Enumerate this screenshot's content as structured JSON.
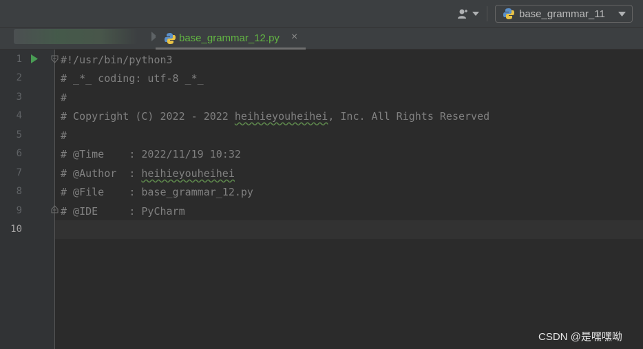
{
  "toolbar": {
    "user_icon": "user-icon",
    "run_config_label": "base_grammar_11",
    "run_config_icon": "python-icon"
  },
  "tabs": [
    {
      "label": "",
      "state": "inactive",
      "blurred": true
    },
    {
      "label": "base_grammar_12.py",
      "state": "active",
      "icon": "python-icon",
      "close": "×"
    }
  ],
  "editor": {
    "lines": [
      {
        "num": "1",
        "pre": "#!/usr/bin/python3",
        "link": "",
        "post": ""
      },
      {
        "num": "2",
        "pre": "# _*_ coding: utf-8 _*_",
        "link": "",
        "post": ""
      },
      {
        "num": "3",
        "pre": "#",
        "link": "",
        "post": ""
      },
      {
        "num": "4",
        "pre": "# Copyright (C) 2022 - 2022 ",
        "link": "heihieyouheihei",
        "post": ", Inc. All Rights Reserved"
      },
      {
        "num": "5",
        "pre": "#",
        "link": "",
        "post": ""
      },
      {
        "num": "6",
        "pre": "# @Time    : 2022/11/19 10:32",
        "link": "",
        "post": ""
      },
      {
        "num": "7",
        "pre": "# @Author  : ",
        "link": "heihieyouheihei",
        "post": ""
      },
      {
        "num": "8",
        "pre": "# @File    : base_grammar_12.py",
        "link": "",
        "post": ""
      },
      {
        "num": "9",
        "pre": "# @IDE     : PyCharm",
        "link": "",
        "post": ""
      },
      {
        "num": "10",
        "pre": "",
        "link": "",
        "post": ""
      }
    ],
    "current_line": "10"
  },
  "watermark": "CSDN @是嘿嘿呦",
  "colors": {
    "background": "#2b2b2b",
    "comment": "#808080",
    "active_tab_text": "#62b543",
    "run_arrow": "#499c54"
  }
}
